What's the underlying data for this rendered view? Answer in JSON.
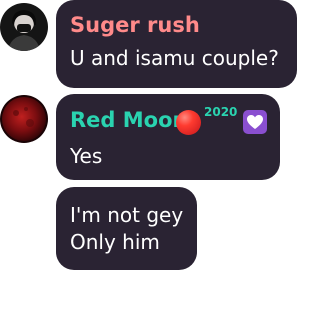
{
  "messages": [
    {
      "author": "Suger rush",
      "author_color": "#ff8a8a",
      "avatar": "dark-profile-avatar",
      "text": "U and isamu couple?"
    },
    {
      "author": "Red Moon",
      "author_color": "#2ad3b0",
      "avatar": "red-moon-avatar",
      "badge_icon": "red-circle-icon",
      "badge_year": "2020",
      "badge_year_color": "#2ad3b0",
      "badge_heart": "purple-heart-icon",
      "text": "Yes"
    },
    {
      "lines": [
        "I'm not gey",
        "Only him"
      ]
    }
  ]
}
